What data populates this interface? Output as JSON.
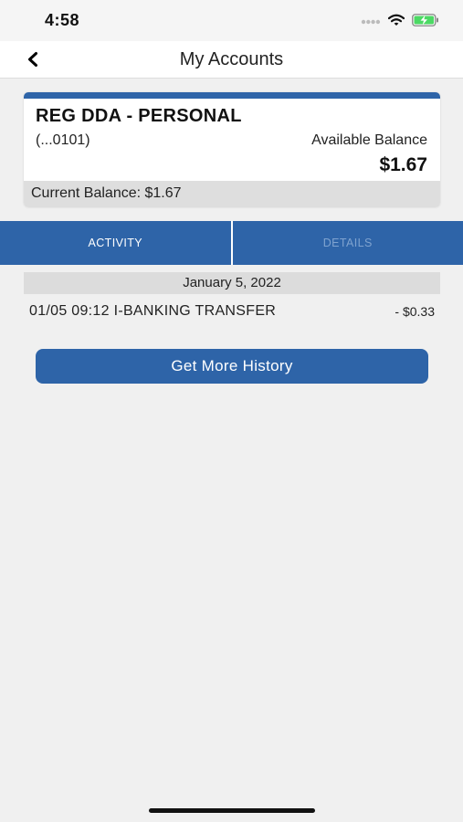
{
  "status_bar": {
    "time": "4:58",
    "icons": [
      "signal-icon",
      "wifi-icon",
      "battery-charging-icon"
    ],
    "battery_color": "#4cd964"
  },
  "nav": {
    "back_icon": "chevron-left-icon",
    "title": "My Accounts"
  },
  "account": {
    "name": "REG DDA - PERSONAL",
    "number": "(...0101)",
    "available_label": "Available Balance",
    "available_amount": "$1.67",
    "current_balance": "Current Balance: $1.67",
    "accent_color": "#2e64a8"
  },
  "tabs": [
    {
      "label": "ACTIVITY",
      "active": true
    },
    {
      "label": "DETAILS",
      "active": false
    }
  ],
  "activity": {
    "date_header": "January 5, 2022",
    "transactions": [
      {
        "description": "01/05 09:12 I-BANKING TRANSFER",
        "amount": "- $0.33"
      }
    ],
    "more_button": "Get More History"
  }
}
